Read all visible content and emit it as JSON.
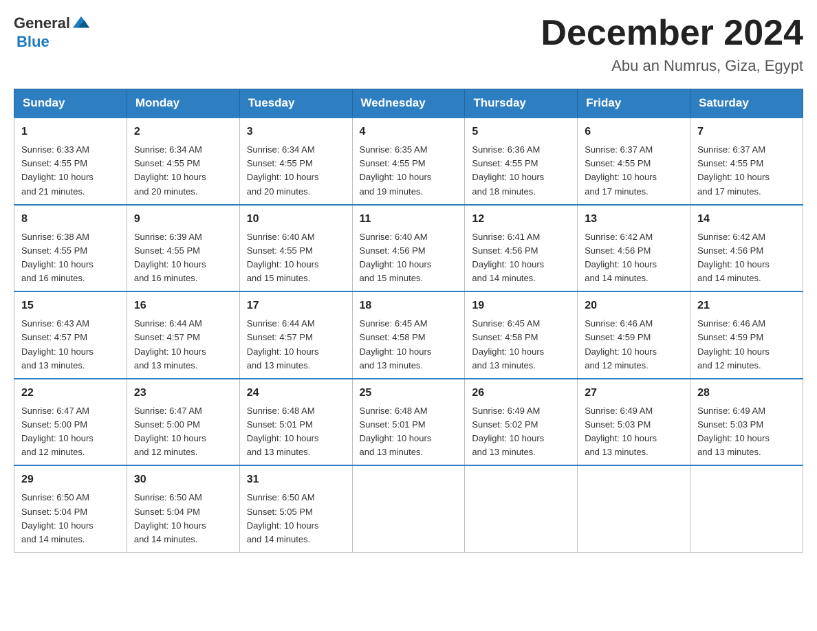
{
  "header": {
    "logo_general": "General",
    "logo_blue": "Blue",
    "title": "December 2024",
    "location": "Abu an Numrus, Giza, Egypt"
  },
  "days_of_week": [
    "Sunday",
    "Monday",
    "Tuesday",
    "Wednesday",
    "Thursday",
    "Friday",
    "Saturday"
  ],
  "weeks": [
    [
      {
        "day": "1",
        "sunrise": "6:33 AM",
        "sunset": "4:55 PM",
        "daylight": "10 hours and 21 minutes."
      },
      {
        "day": "2",
        "sunrise": "6:34 AM",
        "sunset": "4:55 PM",
        "daylight": "10 hours and 20 minutes."
      },
      {
        "day": "3",
        "sunrise": "6:34 AM",
        "sunset": "4:55 PM",
        "daylight": "10 hours and 20 minutes."
      },
      {
        "day": "4",
        "sunrise": "6:35 AM",
        "sunset": "4:55 PM",
        "daylight": "10 hours and 19 minutes."
      },
      {
        "day": "5",
        "sunrise": "6:36 AM",
        "sunset": "4:55 PM",
        "daylight": "10 hours and 18 minutes."
      },
      {
        "day": "6",
        "sunrise": "6:37 AM",
        "sunset": "4:55 PM",
        "daylight": "10 hours and 17 minutes."
      },
      {
        "day": "7",
        "sunrise": "6:37 AM",
        "sunset": "4:55 PM",
        "daylight": "10 hours and 17 minutes."
      }
    ],
    [
      {
        "day": "8",
        "sunrise": "6:38 AM",
        "sunset": "4:55 PM",
        "daylight": "10 hours and 16 minutes."
      },
      {
        "day": "9",
        "sunrise": "6:39 AM",
        "sunset": "4:55 PM",
        "daylight": "10 hours and 16 minutes."
      },
      {
        "day": "10",
        "sunrise": "6:40 AM",
        "sunset": "4:55 PM",
        "daylight": "10 hours and 15 minutes."
      },
      {
        "day": "11",
        "sunrise": "6:40 AM",
        "sunset": "4:56 PM",
        "daylight": "10 hours and 15 minutes."
      },
      {
        "day": "12",
        "sunrise": "6:41 AM",
        "sunset": "4:56 PM",
        "daylight": "10 hours and 14 minutes."
      },
      {
        "day": "13",
        "sunrise": "6:42 AM",
        "sunset": "4:56 PM",
        "daylight": "10 hours and 14 minutes."
      },
      {
        "day": "14",
        "sunrise": "6:42 AM",
        "sunset": "4:56 PM",
        "daylight": "10 hours and 14 minutes."
      }
    ],
    [
      {
        "day": "15",
        "sunrise": "6:43 AM",
        "sunset": "4:57 PM",
        "daylight": "10 hours and 13 minutes."
      },
      {
        "day": "16",
        "sunrise": "6:44 AM",
        "sunset": "4:57 PM",
        "daylight": "10 hours and 13 minutes."
      },
      {
        "day": "17",
        "sunrise": "6:44 AM",
        "sunset": "4:57 PM",
        "daylight": "10 hours and 13 minutes."
      },
      {
        "day": "18",
        "sunrise": "6:45 AM",
        "sunset": "4:58 PM",
        "daylight": "10 hours and 13 minutes."
      },
      {
        "day": "19",
        "sunrise": "6:45 AM",
        "sunset": "4:58 PM",
        "daylight": "10 hours and 13 minutes."
      },
      {
        "day": "20",
        "sunrise": "6:46 AM",
        "sunset": "4:59 PM",
        "daylight": "10 hours and 12 minutes."
      },
      {
        "day": "21",
        "sunrise": "6:46 AM",
        "sunset": "4:59 PM",
        "daylight": "10 hours and 12 minutes."
      }
    ],
    [
      {
        "day": "22",
        "sunrise": "6:47 AM",
        "sunset": "5:00 PM",
        "daylight": "10 hours and 12 minutes."
      },
      {
        "day": "23",
        "sunrise": "6:47 AM",
        "sunset": "5:00 PM",
        "daylight": "10 hours and 12 minutes."
      },
      {
        "day": "24",
        "sunrise": "6:48 AM",
        "sunset": "5:01 PM",
        "daylight": "10 hours and 13 minutes."
      },
      {
        "day": "25",
        "sunrise": "6:48 AM",
        "sunset": "5:01 PM",
        "daylight": "10 hours and 13 minutes."
      },
      {
        "day": "26",
        "sunrise": "6:49 AM",
        "sunset": "5:02 PM",
        "daylight": "10 hours and 13 minutes."
      },
      {
        "day": "27",
        "sunrise": "6:49 AM",
        "sunset": "5:03 PM",
        "daylight": "10 hours and 13 minutes."
      },
      {
        "day": "28",
        "sunrise": "6:49 AM",
        "sunset": "5:03 PM",
        "daylight": "10 hours and 13 minutes."
      }
    ],
    [
      {
        "day": "29",
        "sunrise": "6:50 AM",
        "sunset": "5:04 PM",
        "daylight": "10 hours and 14 minutes."
      },
      {
        "day": "30",
        "sunrise": "6:50 AM",
        "sunset": "5:04 PM",
        "daylight": "10 hours and 14 minutes."
      },
      {
        "day": "31",
        "sunrise": "6:50 AM",
        "sunset": "5:05 PM",
        "daylight": "10 hours and 14 minutes."
      },
      null,
      null,
      null,
      null
    ]
  ],
  "labels": {
    "sunrise": "Sunrise:",
    "sunset": "Sunset:",
    "daylight": "Daylight:"
  }
}
